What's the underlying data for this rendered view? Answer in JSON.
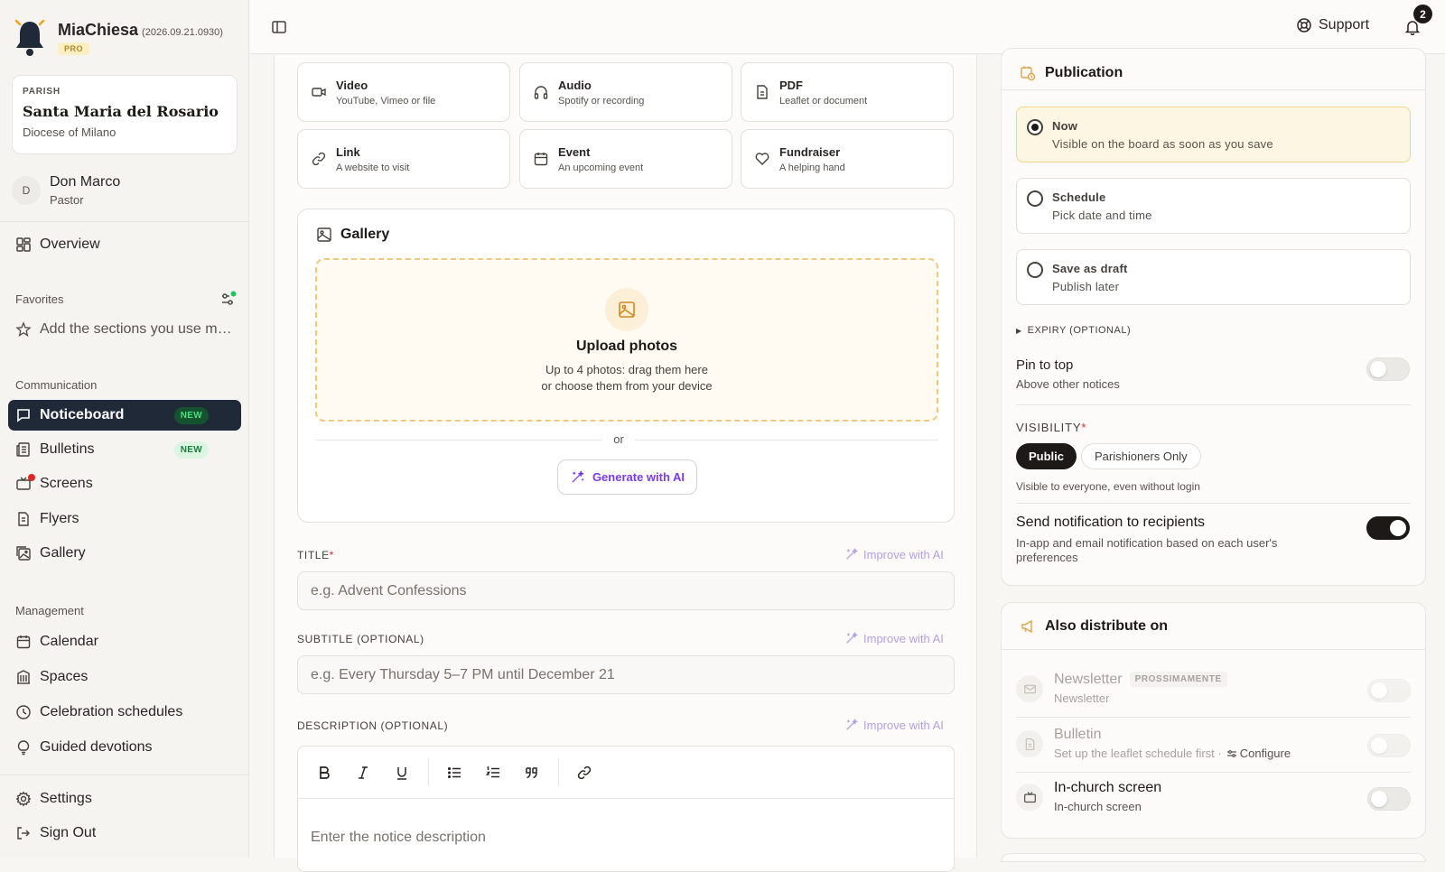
{
  "app": {
    "name": "MiaChiesa",
    "version": "(2026.09.21.0930)",
    "tier": "PRO"
  },
  "parish": {
    "label": "PARISH",
    "name": "Santa Maria del Rosario",
    "diocese": "Diocese of Milano"
  },
  "user": {
    "initial": "D",
    "name": "Don Marco",
    "role": "Pastor"
  },
  "nav": {
    "overview": "Overview",
    "favorites_title": "Favorites",
    "favorites_hint": "Add the sections you use most",
    "communication_title": "Communication",
    "communication": [
      {
        "label": "Noticeboard",
        "badge": "NEW"
      },
      {
        "label": "Bulletins",
        "badge": "NEW"
      },
      {
        "label": "Screens"
      },
      {
        "label": "Flyers"
      },
      {
        "label": "Gallery"
      }
    ],
    "management_title": "Management",
    "management": [
      {
        "label": "Calendar"
      },
      {
        "label": "Spaces"
      },
      {
        "label": "Celebration schedules"
      },
      {
        "label": "Guided devotions"
      }
    ],
    "settings": "Settings",
    "signout": "Sign Out"
  },
  "topbar": {
    "support": "Support",
    "notifications_count": "2"
  },
  "types": [
    {
      "title": "Video",
      "sub": "YouTube, Vimeo or file",
      "icon": "video-icon"
    },
    {
      "title": "Audio",
      "sub": "Spotify or recording",
      "icon": "headphones-icon"
    },
    {
      "title": "PDF",
      "sub": "Leaflet or document",
      "icon": "document-icon"
    },
    {
      "title": "Link",
      "sub": "A website to visit",
      "icon": "link-icon"
    },
    {
      "title": "Event",
      "sub": "An upcoming event",
      "icon": "calendar-icon"
    },
    {
      "title": "Fundraiser",
      "sub": "A helping hand",
      "icon": "heart-icon"
    }
  ],
  "gallery": {
    "title": "Gallery",
    "upload_title": "Upload photos",
    "upload_line1": "Up to 4 photos: drag them here",
    "upload_line2": "or choose them from your device",
    "or": "or",
    "generate": "Generate with AI"
  },
  "form": {
    "improve": "Improve with AI",
    "title_label": "TITLE",
    "title_placeholder": "e.g. Advent Confessions",
    "subtitle_label": "SUBTITLE (OPTIONAL)",
    "subtitle_placeholder": "e.g. Every Thursday 5–7 PM until December 21",
    "description_label": "DESCRIPTION (OPTIONAL)",
    "description_placeholder": "Enter the notice description"
  },
  "publication": {
    "title": "Publication",
    "options": [
      {
        "title": "Now",
        "sub": "Visible on the board as soon as you save",
        "selected": true
      },
      {
        "title": "Schedule",
        "sub": "Pick date and time",
        "selected": false
      },
      {
        "title": "Save as draft",
        "sub": "Publish later",
        "selected": false
      }
    ],
    "expiry": "EXPIRY (OPTIONAL)",
    "pin_title": "Pin to top",
    "pin_sub": "Above other notices",
    "pin_on": false,
    "visibility_label": "VISIBILITY",
    "visibility_options": [
      "Public",
      "Parishioners Only"
    ],
    "visibility_selected": "Public",
    "visibility_hint": "Visible to everyone, even without login",
    "notify_title": "Send notification to recipients",
    "notify_sub": "In-app and email notification based on each user's preferences",
    "notify_on": true
  },
  "distribute": {
    "title": "Also distribute on",
    "items": [
      {
        "title": "Newsletter",
        "badge": "PROSSIMAMENTE",
        "sub": "Newsletter",
        "enabled": false,
        "on": false
      },
      {
        "title": "Bulletin",
        "sub": "Set up the leaflet schedule first ·",
        "action": "Configure",
        "enabled": false,
        "on": false
      },
      {
        "title": "In-church screen",
        "sub": "In-church screen",
        "enabled": true,
        "on": false
      }
    ]
  },
  "colors": {
    "accent_dark": "#1f2937",
    "ai_purple": "#7c3aed",
    "upload_border": "#f0c97d",
    "selected_option": "#fdf6e3",
    "new_badge": "#15803d",
    "alert_red": "#dc2626",
    "online_green": "#22c55e"
  }
}
